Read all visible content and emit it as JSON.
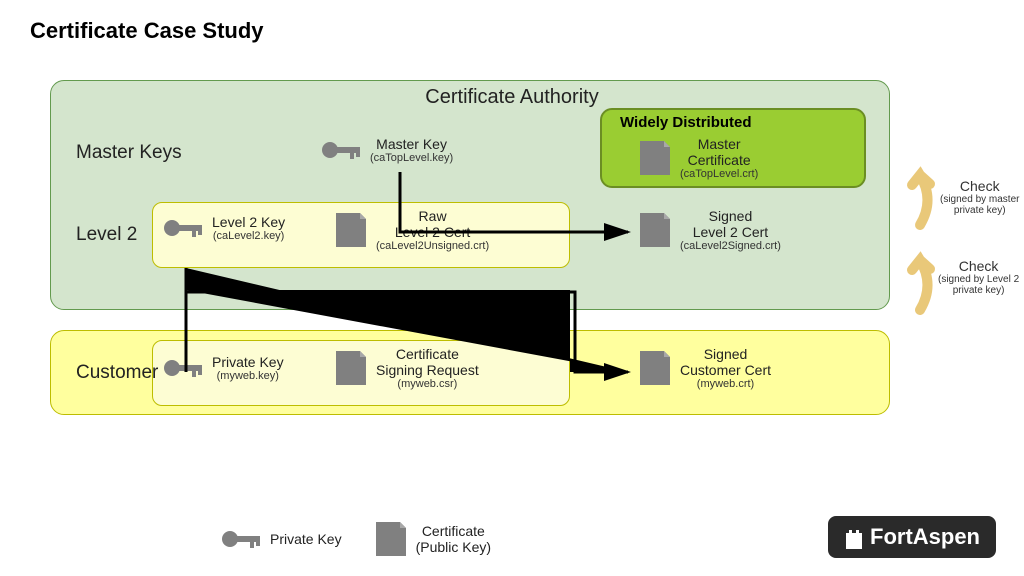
{
  "title": "Certificate Case Study",
  "ca": {
    "title": "Certificate Authority",
    "rows": {
      "master": "Master Keys",
      "level2": "Level 2"
    },
    "widely_distributed": "Widely Distributed",
    "master_key": {
      "name": "Master Key",
      "file": "(caTopLevel.key)"
    },
    "master_cert": {
      "name": "Master\nCertificate",
      "file": "(caTopLevel.crt)"
    },
    "l2_key": {
      "name": "Level 2 Key",
      "file": "(caLevel2.key)"
    },
    "l2_raw": {
      "name": "Raw\nLevel 2 Cert",
      "file": "(caLevel2Unsigned.crt)"
    },
    "l2_signed": {
      "name": "Signed\nLevel 2 Cert",
      "file": "(caLevel2Signed.crt)"
    }
  },
  "customer": {
    "label": "Customer",
    "priv": {
      "name": "Private Key",
      "file": "(myweb.key)"
    },
    "csr": {
      "name": "Certificate\nSigning Request",
      "file": "(myweb.csr)"
    },
    "signed": {
      "name": "Signed\nCustomer Cert",
      "file": "(myweb.crt)"
    }
  },
  "checks": {
    "c1": {
      "label": "Check",
      "sub": "(signed by master\nprivate key)"
    },
    "c2": {
      "label": "Check",
      "sub": "(signed by Level 2\nprivate key)"
    }
  },
  "legend": {
    "priv": "Private Key",
    "cert": "Certificate\n(Public Key)"
  },
  "brand": "FortAspen"
}
